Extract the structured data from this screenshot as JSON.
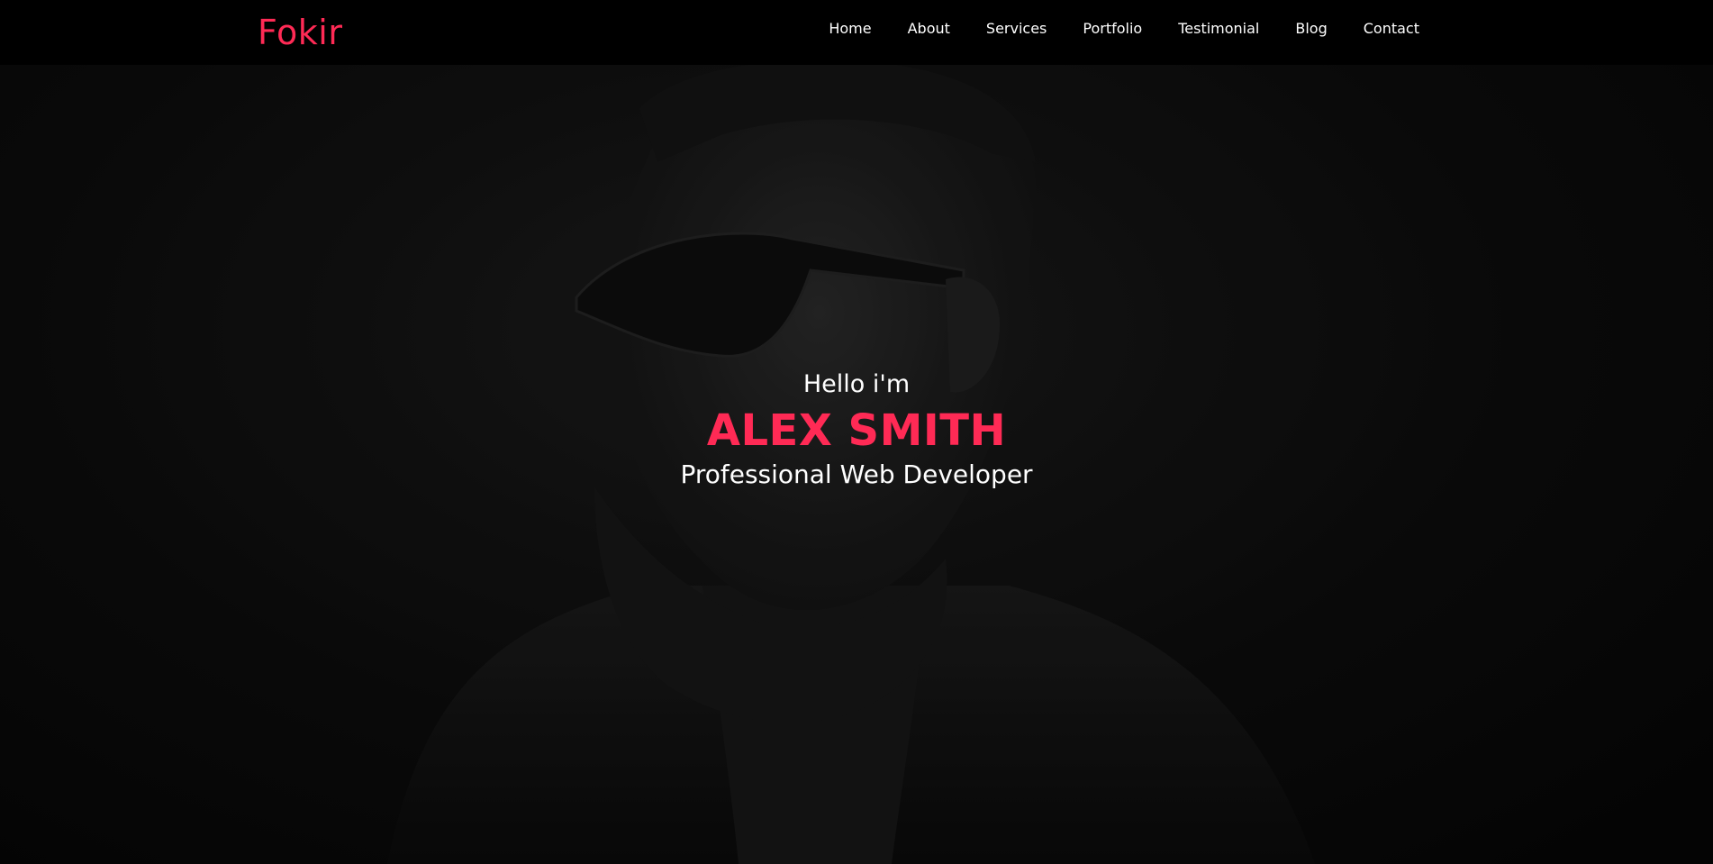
{
  "brand": {
    "name": "Fokir",
    "accent_color": "#ff2a55"
  },
  "nav": {
    "items": [
      {
        "label": "Home"
      },
      {
        "label": "About"
      },
      {
        "label": "Services"
      },
      {
        "label": "Portfolio"
      },
      {
        "label": "Testimonial"
      },
      {
        "label": "Blog"
      },
      {
        "label": "Contact"
      }
    ]
  },
  "hero": {
    "intro": "Hello i'm",
    "name": "ALEX SMITH",
    "role": "Professional Web Developer"
  }
}
